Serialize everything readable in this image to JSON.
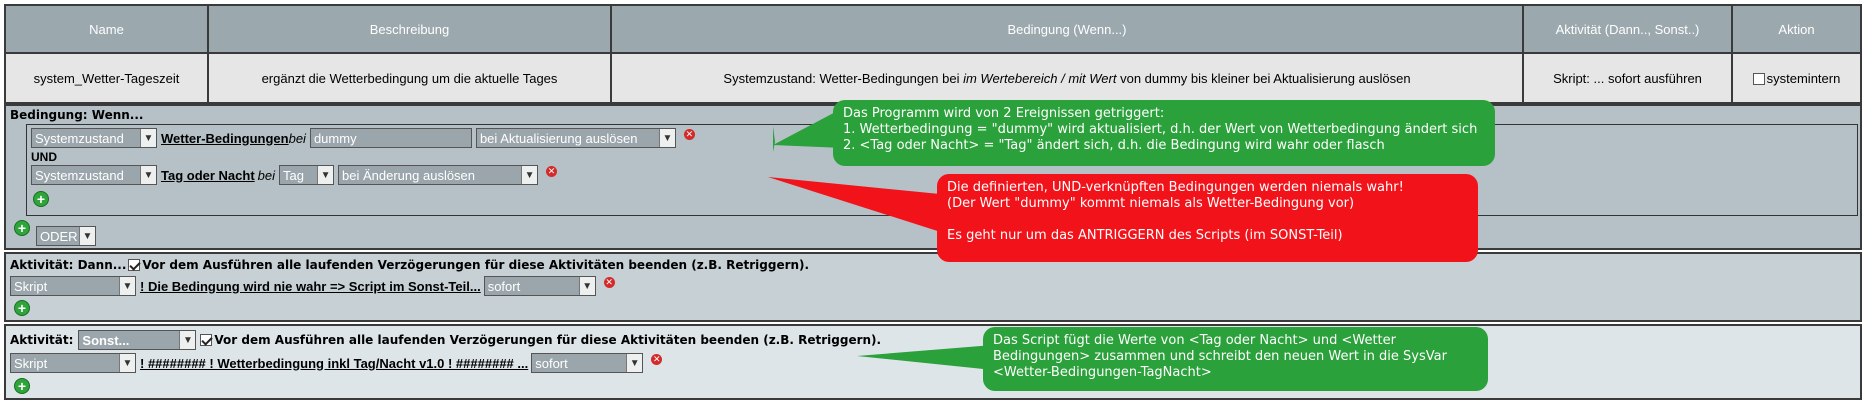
{
  "header": {
    "columns": [
      "Name",
      "Beschreibung",
      "Bedingung (Wenn...)",
      "Aktivität (Dann.., Sonst..)",
      "Aktion"
    ],
    "row": {
      "name": "system_Wetter-Tageszeit",
      "description": "ergänzt die Wetterbedingung um die aktuelle Tages",
      "condition_part1": "Systemzustand: Wetter-Bedingungen bei ",
      "condition_italic": "im Wertebereich / mit Wert",
      "condition_part2": " von dummy bis kleiner bei Aktualisierung auslösen",
      "activity": "Skript: ... sofort ausführen",
      "action_label": "systemintern"
    }
  },
  "condition": {
    "title": "Bedingung: Wenn...",
    "row1": {
      "select": "Systemzustand",
      "link": "Wetter-Bedingungen",
      "bei": "bei",
      "value": "dummy",
      "trigger": "bei Aktualisierung auslösen"
    },
    "und": "UND",
    "row2": {
      "select": "Systemzustand",
      "link": "Tag oder Nacht",
      "bei": "bei",
      "value": "Tag",
      "trigger": "bei Änderung auslösen"
    },
    "oder": "ODER"
  },
  "then": {
    "title": "Aktivität: Dann...",
    "option": "Vor dem Ausführen alle laufenden Verzögerungen für diese Aktivitäten beenden (z.B. Retriggern).",
    "select": "Skript",
    "link": "! Die Bedingung wird nie wahr => Script im Sonst-Teil...",
    "timing": "sofort"
  },
  "else": {
    "title": "Aktivität:",
    "mode": "Sonst...",
    "option": "Vor dem Ausführen alle laufenden Verzögerungen für diese Aktivitäten beenden (z.B. Retriggern).",
    "select": "Skript",
    "link": "! ######## ! Wetterbedingung inkl Tag/Nacht v1.0 ! ######## ...",
    "timing": "sofort"
  },
  "callouts": {
    "green_top": [
      "Das Programm wird von 2 Ereignissen getriggert:",
      "1. Wetterbedingung = \"dummy\" wird aktualisiert, d.h. der Wert von Wetterbedingung ändert sich",
      "2. <Tag oder Nacht> = \"Tag\" ändert sich, d.h. die Bedingung wird wahr oder flasch"
    ],
    "red": [
      "Die definierten, UND-verknüpften Bedingungen werden niemals wahr!",
      "(Der Wert \"dummy\" kommt niemals als Wetter-Bedingung vor)",
      "",
      "Es geht nur um das ANTRIGGERN des Scripts (im SONST-Teil)"
    ],
    "green_bottom": [
      "Das Script fügt die Werte von <Tag oder Nacht> und <Wetter",
      "Bedingungen> zusammen und schreibt den neuen Wert in die SysVar",
      "<Wetter-Bedingungen-TagNacht>"
    ]
  },
  "colors": {
    "header_bg": "#9ba8ad",
    "callout_green": "#2aa13a",
    "callout_red": "#f2121a"
  }
}
